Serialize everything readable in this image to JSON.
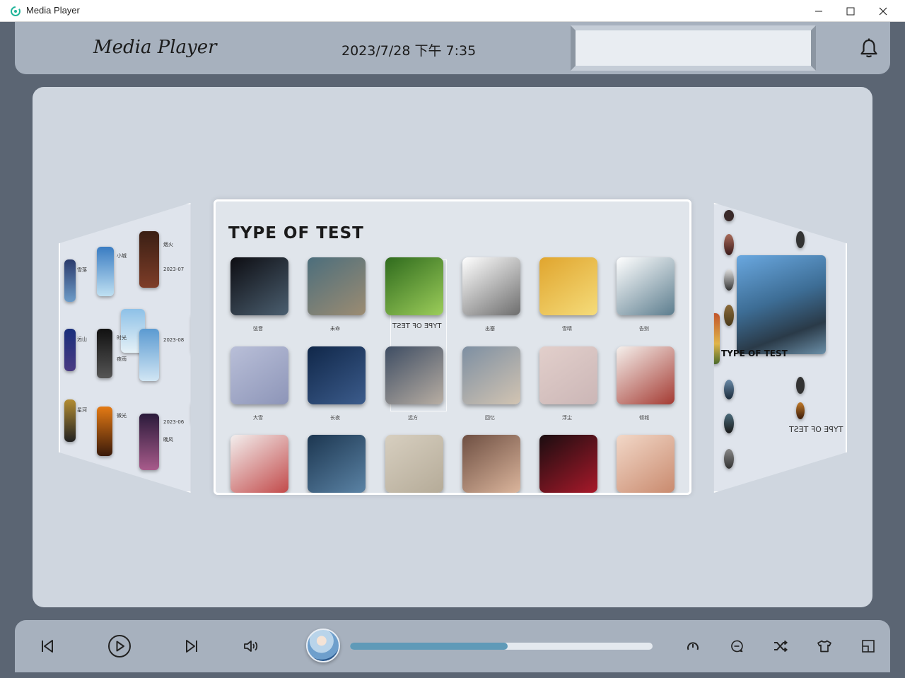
{
  "window": {
    "title": "Media Player",
    "minimize_glyph": "─",
    "maximize_glyph": "☐",
    "close_glyph": "✕"
  },
  "header": {
    "app_name": "Media Player",
    "datetime": "2023/7/28 下午 7:35",
    "search_value": "",
    "notification_icon": "bell-icon"
  },
  "carousel": {
    "main_panel": {
      "title": "TYPE OF TEST",
      "mirrored_label": "TYPE OF TEST",
      "albums": [
        {
          "caption": "弦音",
          "colors": [
            "#0d0d12",
            "#4b5f70"
          ]
        },
        {
          "caption": "未命",
          "colors": [
            "#4c6e7c",
            "#9c8c72"
          ]
        },
        {
          "caption": "",
          "colors": [
            "#2f6b1d",
            "#9ccd5a"
          ]
        },
        {
          "caption": "出塞",
          "colors": [
            "#ffffff",
            "#6d6d6d"
          ]
        },
        {
          "caption": "雪晴",
          "colors": [
            "#e0a52e",
            "#f5dc7a"
          ]
        },
        {
          "caption": "告别",
          "colors": [
            "#ffffff",
            "#5c7d8e"
          ]
        },
        {
          "caption": "大雪",
          "colors": [
            "#b9bfd8",
            "#8d95b8"
          ]
        },
        {
          "caption": "长夜",
          "colors": [
            "#102749",
            "#3c5c8c"
          ]
        },
        {
          "caption": "远方",
          "colors": [
            "#3e4d63",
            "#b8aea3"
          ]
        },
        {
          "caption": "回忆",
          "colors": [
            "#7d8fa2",
            "#d2c4b2"
          ]
        },
        {
          "caption": "浮尘",
          "colors": [
            "#e2cfcb",
            "#cbb6b6"
          ]
        },
        {
          "caption": "倾城",
          "colors": [
            "#f5f0ec",
            "#a43a32"
          ]
        },
        {
          "caption": "",
          "colors": [
            "#f3efee",
            "#c24a4a"
          ]
        },
        {
          "caption": "",
          "colors": [
            "#1c3650",
            "#5b83a5"
          ]
        },
        {
          "caption": "",
          "colors": [
            "#d7cfc0",
            "#b5ab98"
          ]
        },
        {
          "caption": "",
          "colors": [
            "#6e4f42",
            "#dbb59c"
          ]
        },
        {
          "caption": "",
          "colors": [
            "#1a0d10",
            "#a8192a"
          ]
        },
        {
          "caption": "",
          "colors": [
            "#f2d8c8",
            "#c98a6e"
          ]
        }
      ]
    },
    "left_panel": {
      "mirrored_label": "TYPE OF TEST",
      "texts": [
        "雪落",
        "小城",
        "烟火",
        "2023-07",
        "远山",
        "时光",
        "2023-08",
        "星河",
        "微光",
        "2023-06",
        "夜雨",
        "晚风"
      ]
    },
    "right_panel": {
      "label": "TYPE OF TEST",
      "mirrored_label": "TYPE OF TEST"
    }
  },
  "player": {
    "progress_percent": 52
  }
}
